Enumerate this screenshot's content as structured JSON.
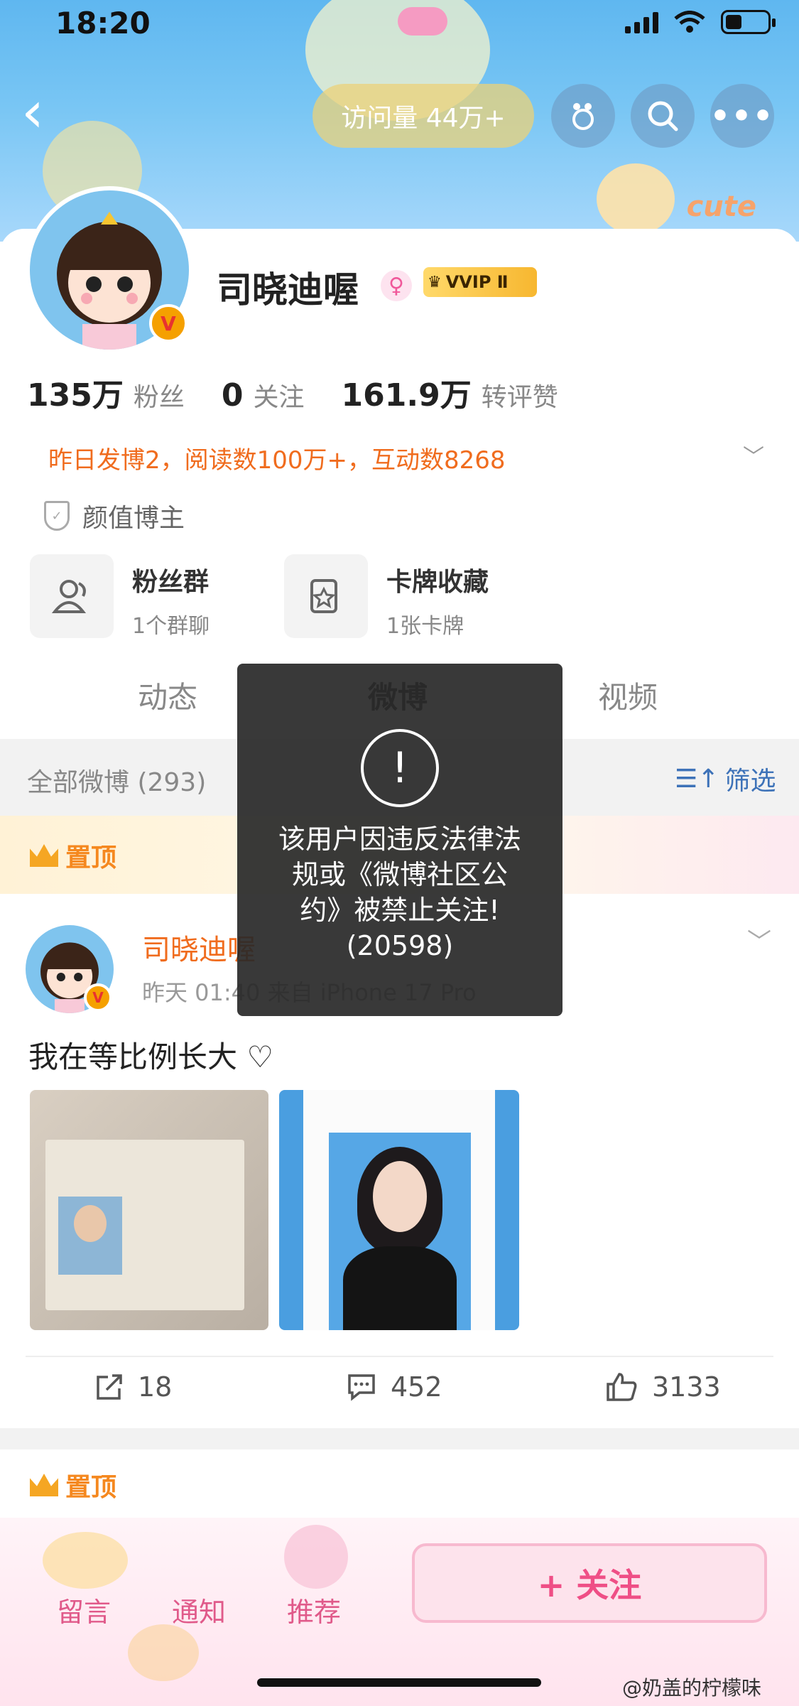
{
  "status_bar": {
    "time": "18:20"
  },
  "header": {
    "visits": "访问量 44万+",
    "banner_tag": "cute"
  },
  "profile": {
    "name": "司晓迪喔",
    "vvip": "VVIP Ⅱ",
    "stats": [
      {
        "value": "135万",
        "label": "粉丝"
      },
      {
        "value": "0",
        "label": "关注"
      },
      {
        "value": "161.9万",
        "label": "转评赞"
      }
    ],
    "yesterday": "昨日发博2，阅读数100万+，互动数8268",
    "tag": "颜值博主",
    "features": [
      {
        "title": "粉丝群",
        "subtitle": "1个群聊"
      },
      {
        "title": "卡牌收藏",
        "subtitle": "1张卡牌"
      }
    ]
  },
  "tabs": [
    "动态",
    "微博",
    "视频"
  ],
  "filter": {
    "all": "全部微博 (293)",
    "filter_label": "筛选"
  },
  "pinned_label": "置顶",
  "post": {
    "author": "司晓迪喔",
    "meta": "昨天 01:40 来自 iPhone 17 Pro",
    "text": "我在等比例长大 ♡",
    "actions": [
      {
        "icon": "share-icon",
        "count": "18"
      },
      {
        "icon": "comment-icon",
        "count": "452"
      },
      {
        "icon": "like-icon",
        "count": "3133"
      }
    ]
  },
  "bottom_bar": {
    "items": [
      "留言",
      "通知",
      "推荐"
    ],
    "follow": "+ 关注"
  },
  "toast": {
    "message": "该用户因违反法律法\n规或《微博社区公\n约》被禁止关注!\n(20598)"
  },
  "watermark": "@奶盖的柠檬味",
  "colors": {
    "accent_orange": "#f06c1e",
    "follow_pink": "#ef4f86",
    "link_blue": "#3d72b8"
  }
}
